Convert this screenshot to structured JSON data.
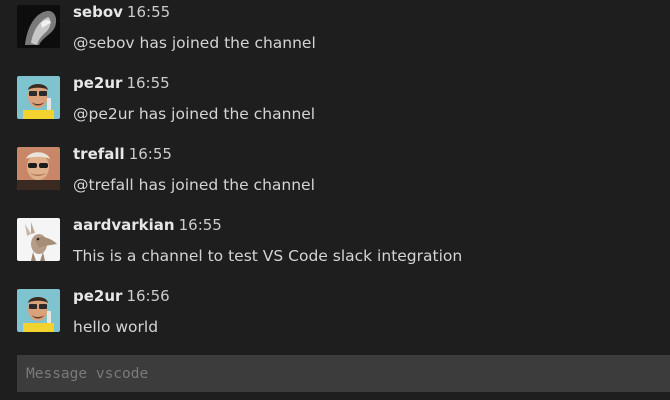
{
  "channel": "vscode",
  "messages": [
    {
      "author": "sebov",
      "time": "16:55",
      "text": "@sebov has joined the channel",
      "avatar": "sebov-avatar"
    },
    {
      "author": "pe2ur",
      "time": "16:55",
      "text": "@pe2ur has joined the channel",
      "avatar": "pe2ur-avatar"
    },
    {
      "author": "trefall",
      "time": "16:55",
      "text": "@trefall has joined the channel",
      "avatar": "trefall-avatar"
    },
    {
      "author": "aardvarkian",
      "time": "16:55",
      "text": "This is a channel to test VS Code slack integration",
      "avatar": "aardvark-avatar"
    },
    {
      "author": "pe2ur",
      "time": "16:56",
      "text": "hello world",
      "avatar": "pe2ur-avatar"
    }
  ],
  "composer": {
    "placeholder": "Message vscode",
    "value": ""
  },
  "colors": {
    "background": "#1e1e1e",
    "input_background": "#3c3c3c",
    "author_text": "#e7e7e7",
    "message_text": "#d4d4d4",
    "placeholder_text": "#7a7a7a"
  }
}
